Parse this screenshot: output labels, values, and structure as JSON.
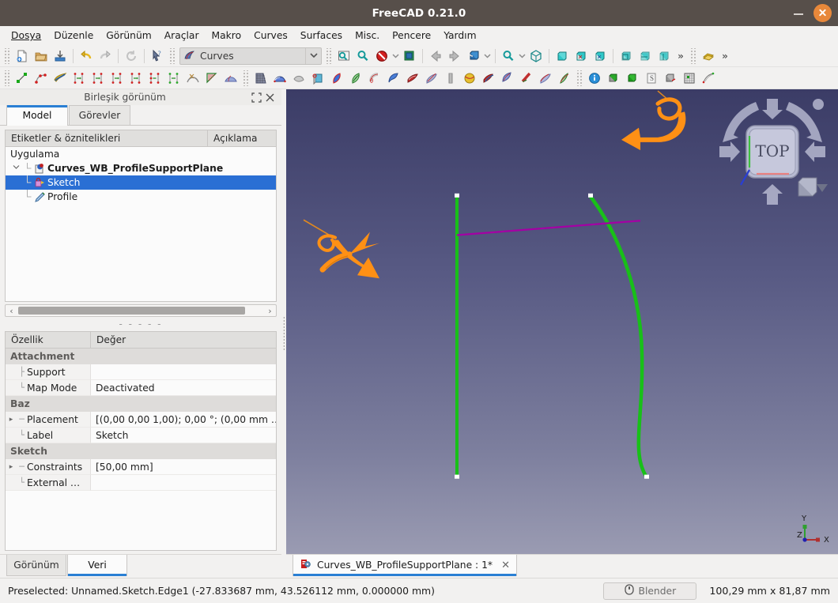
{
  "window": {
    "title": "FreeCAD 0.21.0",
    "minimize_label": "–",
    "close_label": "×"
  },
  "menubar": {
    "items": [
      {
        "label": "Dosya",
        "mnemonic_index": 0
      },
      {
        "label": "Düzenle",
        "mnemonic_index": 2
      },
      {
        "label": "Görünüm",
        "mnemonic_index": 0
      },
      {
        "label": "Araçlar",
        "mnemonic_index": -1
      },
      {
        "label": "Makro",
        "mnemonic_index": 0
      },
      {
        "label": "Curves",
        "mnemonic_index": -1
      },
      {
        "label": "Surfaces",
        "mnemonic_index": -1
      },
      {
        "label": "Misc.",
        "mnemonic_index": -1
      },
      {
        "label": "Pencere",
        "mnemonic_index": 0
      },
      {
        "label": "Yardım",
        "mnemonic_index": 0
      }
    ]
  },
  "toolbar": {
    "workbench_selector": {
      "value": "Curves",
      "icon": "curves-workbench-icon",
      "arrow": "chevron-down-icon"
    },
    "file_buttons": [
      {
        "name": "new-document-button",
        "icon": "new-document-icon"
      },
      {
        "name": "open-document-button",
        "icon": "open-folder-icon"
      },
      {
        "name": "save-document-button",
        "icon": "save-icon"
      },
      {
        "name": "undo-button",
        "icon": "undo-arrow-icon"
      },
      {
        "name": "redo-button",
        "icon": "redo-arrow-icon"
      },
      {
        "name": "refresh-button",
        "icon": "refresh-icon"
      },
      {
        "name": "whats-this-button",
        "icon": "cursor-question-icon"
      }
    ],
    "view_buttons": [
      {
        "name": "fit-all-button",
        "icon": "fit-all-icon"
      },
      {
        "name": "fit-selection-button",
        "icon": "magnifier-icon"
      },
      {
        "name": "draw-style-button",
        "icon": "no-entry-icon"
      },
      {
        "name": "draw-style-dropdown",
        "icon": "chevron-down-icon"
      },
      {
        "name": "box-selection-button",
        "icon": "box-select-icon"
      },
      {
        "name": "back-view-button",
        "icon": "arrow-left-icon"
      },
      {
        "name": "forward-view-button",
        "icon": "arrow-right-icon"
      },
      {
        "name": "isometric-view-button",
        "icon": "axonometric-cube-icon"
      },
      {
        "name": "isometric-dropdown",
        "icon": "chevron-down-icon"
      },
      {
        "name": "zoom-button",
        "icon": "zoom-icon"
      },
      {
        "name": "zoom-dropdown",
        "icon": "chevron-down-icon"
      },
      {
        "name": "axonometric-button",
        "icon": "wireframe-cube-icon"
      },
      {
        "name": "front-view-button",
        "icon": "cube-front-icon"
      },
      {
        "name": "top-view-button",
        "icon": "cube-top-icon"
      },
      {
        "name": "right-view-button",
        "icon": "cube-right-icon"
      },
      {
        "name": "rear-view-button",
        "icon": "cube-rear-icon"
      },
      {
        "name": "bottom-view-button",
        "icon": "cube-bottom-icon"
      },
      {
        "name": "left-view-button",
        "icon": "cube-left-icon"
      },
      {
        "name": "view-overflow-button",
        "icon": "double-chevron-icon"
      },
      {
        "name": "measure-button",
        "icon": "gold-stack-icon"
      },
      {
        "name": "toolbar-overflow-button",
        "icon": "double-chevron-icon"
      }
    ],
    "curves_buttons": [
      {
        "name": "line-tool-button",
        "icon": "green-line-icon"
      },
      {
        "name": "bspline-tool-button",
        "icon": "bspline-icon"
      },
      {
        "name": "editable-spline-button",
        "icon": "gold-spline-icon"
      },
      {
        "name": "join-curve-button-1",
        "icon": "join-curve-icon"
      },
      {
        "name": "join-curve-button-2",
        "icon": "join-curve-icon"
      },
      {
        "name": "join-curve-button-3",
        "icon": "join-curve-icon"
      },
      {
        "name": "join-curve-button-4",
        "icon": "join-curve-icon"
      },
      {
        "name": "join-curve-button-5",
        "icon": "join-curve-icon"
      },
      {
        "name": "join-curve-button-6",
        "icon": "join-curve-green-icon"
      },
      {
        "name": "blend-curve-button",
        "icon": "blend-arc-icon"
      },
      {
        "name": "comb-plot-button",
        "icon": "comb-plot-icon"
      },
      {
        "name": "zebra-button",
        "icon": "zebra-fan-icon"
      }
    ],
    "surfaces_buttons": [
      {
        "name": "surface-grid-button",
        "icon": "surface-grid-icon"
      },
      {
        "name": "loft-surface-button",
        "icon": "loft-surface-icon"
      },
      {
        "name": "flatten-surface-button",
        "icon": "flatten-surface-icon"
      },
      {
        "name": "profile-support-button",
        "icon": "profile-support-icon"
      },
      {
        "name": "blue-leaf-button",
        "icon": "blue-leaf-icon"
      },
      {
        "name": "green-profile-button",
        "icon": "green-profile-icon"
      },
      {
        "name": "pipeshell-button",
        "icon": "pipeshell-icon"
      },
      {
        "name": "sweep-button",
        "icon": "sweep-surface-icon"
      },
      {
        "name": "ribbon-button",
        "icon": "ribbon-surface-icon"
      },
      {
        "name": "isocurve-button",
        "icon": "isocurve-icon"
      },
      {
        "name": "segment-button",
        "icon": "segment-icon"
      },
      {
        "name": "sphere-button",
        "icon": "gold-sphere-icon"
      },
      {
        "name": "sphere2-button",
        "icon": "gold-sphere-icon"
      },
      {
        "name": "multi-surface-button",
        "icon": "multi-surface-icon"
      },
      {
        "name": "approx-button",
        "icon": "approx-surface-icon"
      },
      {
        "name": "hook-button",
        "icon": "hook-curve-icon"
      },
      {
        "name": "mix-button",
        "icon": "mix-surface-icon"
      },
      {
        "name": "rotate-sweep-button",
        "icon": "rotate-sweep-icon"
      }
    ],
    "misc_buttons": [
      {
        "name": "info-button",
        "icon": "info-circle-icon"
      },
      {
        "name": "solid-cube-button",
        "icon": "grey-green-cube-icon"
      },
      {
        "name": "green-cube-button",
        "icon": "green-cube-icon"
      },
      {
        "name": "script-button",
        "icon": "script-page-icon"
      },
      {
        "name": "axis-cube-button",
        "icon": "axis-cube-icon"
      },
      {
        "name": "grid-button",
        "icon": "grid-icon"
      },
      {
        "name": "nurbs-button",
        "icon": "nurbs-icon"
      }
    ]
  },
  "combo_view": {
    "dock_title": "Birleşik görünüm",
    "float_icon": "expand-icon",
    "close_icon": "close-icon",
    "tabs": [
      {
        "label": "Model",
        "active": true
      },
      {
        "label": "Görevler",
        "active": false
      }
    ],
    "tree": {
      "columns": [
        "Etiketler & öznitelikleri",
        "Açıklama"
      ],
      "rows": [
        {
          "label": "Uygulama",
          "depth": 0,
          "bold": false,
          "selected": false,
          "icon": "none",
          "twisty": ""
        },
        {
          "label": "Curves_WB_ProfileSupportPlane",
          "depth": 1,
          "bold": true,
          "selected": false,
          "icon": "document-icon",
          "twisty": "expanded"
        },
        {
          "label": "Sketch",
          "depth": 2,
          "bold": false,
          "selected": true,
          "icon": "sketch-icon",
          "twisty": ""
        },
        {
          "label": "Profile",
          "depth": 2,
          "bold": false,
          "selected": false,
          "icon": "profile-icon",
          "twisty": ""
        }
      ]
    },
    "splitter_glyph": "- - - - -",
    "properties": {
      "columns": [
        "Özellik",
        "Değer"
      ],
      "rows": [
        {
          "type": "group",
          "name": "Attachment"
        },
        {
          "type": "prop",
          "name": "Support",
          "value": "",
          "expandable": false
        },
        {
          "type": "prop",
          "name": "Map Mode",
          "value": "Deactivated",
          "expandable": false,
          "last_in_group": true
        },
        {
          "type": "group",
          "name": "Baz"
        },
        {
          "type": "prop",
          "name": "Placement",
          "value": "[(0,00 0,00 1,00); 0,00 °; (0,00 mm  …",
          "expandable": true
        },
        {
          "type": "prop",
          "name": "Label",
          "value": "Sketch",
          "expandable": false,
          "last_in_group": true
        },
        {
          "type": "group",
          "name": "Sketch"
        },
        {
          "type": "prop",
          "name": "Constraints",
          "value": "[50,00 mm]",
          "expandable": true
        },
        {
          "type": "prop",
          "name": "External …",
          "value": "",
          "expandable": false,
          "last_in_group": true
        }
      ]
    },
    "bottom_tabs": [
      {
        "label": "Görünüm",
        "active": false
      },
      {
        "label": "Veri",
        "active": true
      }
    ]
  },
  "viewport": {
    "navigation_cube": {
      "face_label": "TOP",
      "arrow_up_icon": "nav-arrow-up-icon",
      "arrow_down_icon": "nav-arrow-down-icon",
      "arrow_left_icon": "nav-arrow-left-icon",
      "arrow_right_icon": "nav-arrow-right-icon",
      "rotate_left_icon": "nav-rotate-left-icon",
      "rotate_right_icon": "nav-rotate-right-icon",
      "home_icon": "nav-home-dot-icon",
      "corner_cube_icon": "nav-corner-cube-icon",
      "corner_menu_icon": "nav-corner-menu-icon"
    },
    "axis_indicator": {
      "x_label": "X",
      "y_label": "Y",
      "z_label": "Z",
      "x_color": "#b03030",
      "y_color": "#2fa02f",
      "z_color": "#2020b0"
    },
    "colors": {
      "background_top": "#3b3c66",
      "background_bottom": "#9a9bb2",
      "sketch_line": "#18b818",
      "profile_curve": "#18b818",
      "preselected_edge": "#a000a0",
      "annotation_arrow": "#ff9015"
    },
    "document_tab": {
      "icon": "freecad-doc-icon",
      "label": "Curves_WB_ProfileSupportPlane  : 1*",
      "close_icon": "close-icon"
    }
  },
  "statusbar": {
    "message": "Preselected: Unnamed.Sketch.Edge1 (-27.833687 mm, 43.526112 mm, 0.000000 mm)",
    "nav_button": {
      "label": "Blender",
      "icon": "mouse-icon"
    },
    "dimensions": "100,29 mm x 81,87 mm"
  }
}
